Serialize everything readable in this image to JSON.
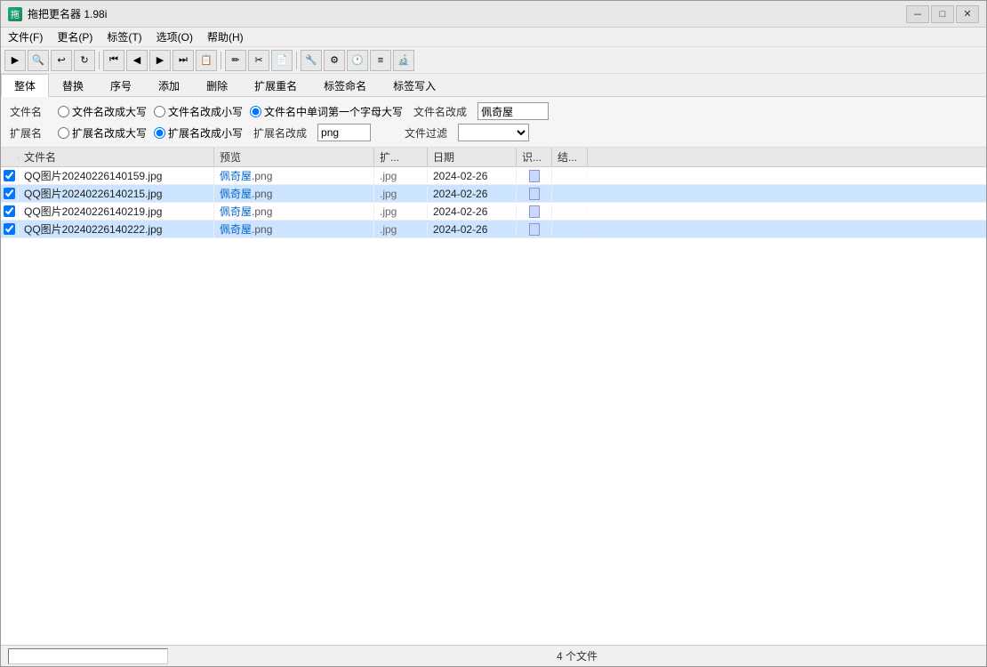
{
  "window": {
    "title": "拖把更名器 1.98i",
    "icon": "app-icon"
  },
  "titlebar": {
    "minimize_label": "－",
    "maximize_label": "□",
    "close_label": "✕"
  },
  "menubar": {
    "items": [
      {
        "id": "file",
        "label": "文件(F)"
      },
      {
        "id": "rename",
        "label": "更名(P)"
      },
      {
        "id": "tag",
        "label": "标签(T)"
      },
      {
        "id": "options",
        "label": "选项(O)"
      },
      {
        "id": "help",
        "label": "帮助(H)"
      }
    ]
  },
  "tabs": {
    "items": [
      {
        "id": "whole",
        "label": "整体",
        "active": true
      },
      {
        "id": "replace",
        "label": "替换"
      },
      {
        "id": "sequence",
        "label": "序号"
      },
      {
        "id": "add",
        "label": "添加"
      },
      {
        "id": "delete",
        "label": "删除"
      },
      {
        "id": "ext",
        "label": "扩展重名"
      },
      {
        "id": "tag_name",
        "label": "标签命名"
      },
      {
        "id": "tag_write",
        "label": "标签写入"
      }
    ]
  },
  "options": {
    "filename_section_label": "文件名",
    "filename_options": [
      {
        "id": "uppercase",
        "label": "文件名改成大写",
        "checked": false
      },
      {
        "id": "lowercase",
        "label": "文件名改成小写",
        "checked": false
      },
      {
        "id": "title_case",
        "label": "文件名中单词第一个字母大写",
        "checked": true
      }
    ],
    "filename_change_label": "文件名改成",
    "filename_change_value": "佩奇屋",
    "ext_section_label": "扩展名",
    "ext_options": [
      {
        "id": "ext_uppercase",
        "label": "扩展名改成大写",
        "checked": false
      },
      {
        "id": "ext_lowercase",
        "label": "扩展名改成小写",
        "checked": true
      }
    ],
    "ext_change_label": "扩展名改成",
    "ext_change_value": "png",
    "file_filter_label": "文件过滤",
    "file_filter_value": ""
  },
  "table": {
    "headers": [
      {
        "id": "check",
        "label": ""
      },
      {
        "id": "filename",
        "label": "文件名"
      },
      {
        "id": "preview",
        "label": "预览"
      },
      {
        "id": "ext",
        "label": "扩..."
      },
      {
        "id": "date",
        "label": "日期"
      },
      {
        "id": "id_col",
        "label": "识..."
      },
      {
        "id": "result",
        "label": "结..."
      }
    ],
    "rows": [
      {
        "checked": true,
        "filename": "QQ图片20240226140159.jpg",
        "preview_name": "佩奇屋",
        "preview_ext": ".png",
        "ext": ".jpg",
        "date": "2024-02-26",
        "has_icon": true,
        "selected": false
      },
      {
        "checked": true,
        "filename": "QQ图片20240226140215.jpg",
        "preview_name": "佩奇屋",
        "preview_ext": ".png",
        "ext": ".jpg",
        "date": "2024-02-26",
        "has_icon": true,
        "selected": true
      },
      {
        "checked": true,
        "filename": "QQ图片20240226140219.jpg",
        "preview_name": "佩奇屋",
        "preview_ext": ".png",
        "ext": ".jpg",
        "date": "2024-02-26",
        "has_icon": true,
        "selected": false
      },
      {
        "checked": true,
        "filename": "QQ图片20240226140222.jpg",
        "preview_name": "佩奇屋",
        "preview_ext": ".png",
        "ext": ".jpg",
        "date": "2024-02-26",
        "has_icon": true,
        "selected": true
      }
    ]
  },
  "statusbar": {
    "file_count": "4 个文件"
  },
  "toolbar": {
    "buttons": [
      "▶",
      "🔍",
      "↩",
      "↻",
      "|",
      "⏮",
      "◀",
      "▶",
      "⏭",
      "📋",
      "|",
      "✏",
      "✂",
      "📄",
      "|",
      "🔧",
      "⚙",
      "🕐",
      "≡",
      "🔬"
    ]
  }
}
